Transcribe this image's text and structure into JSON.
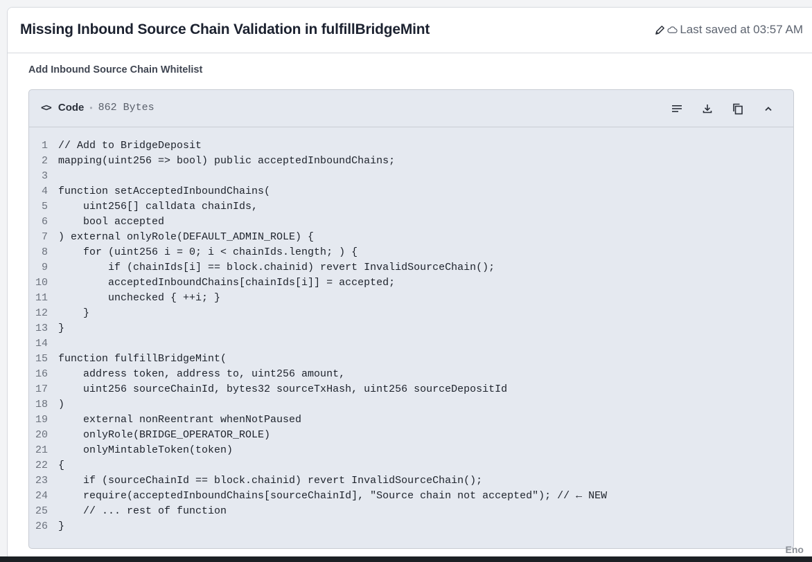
{
  "header": {
    "title": "Missing Inbound Source Chain Validation in fulfillBridgeMint",
    "saved_text": "Last saved at 03:57 AM"
  },
  "section": {
    "label": "Add Inbound Source Chain Whitelist"
  },
  "code_block": {
    "label": "Code",
    "size": "862 Bytes",
    "icon_label": "<>",
    "actions": [
      "wrap-lines",
      "download",
      "copy",
      "collapse"
    ],
    "lines": [
      {
        "n": "1",
        "text": "// Add to BridgeDeposit"
      },
      {
        "n": "2",
        "text": "mapping(uint256 => bool) public acceptedInboundChains;"
      },
      {
        "n": "3",
        "text": ""
      },
      {
        "n": "4",
        "text": "function setAcceptedInboundChains("
      },
      {
        "n": "5",
        "text": "    uint256[] calldata chainIds,"
      },
      {
        "n": "6",
        "text": "    bool accepted"
      },
      {
        "n": "7",
        "text": ") external onlyRole(DEFAULT_ADMIN_ROLE) {"
      },
      {
        "n": "8",
        "text": "    for (uint256 i = 0; i < chainIds.length; ) {"
      },
      {
        "n": "9",
        "text": "        if (chainIds[i] == block.chainid) revert InvalidSourceChain();"
      },
      {
        "n": "10",
        "text": "        acceptedInboundChains[chainIds[i]] = accepted;"
      },
      {
        "n": "11",
        "text": "        unchecked { ++i; }"
      },
      {
        "n": "12",
        "text": "    }"
      },
      {
        "n": "13",
        "text": "}"
      },
      {
        "n": "14",
        "text": ""
      },
      {
        "n": "15",
        "text": "function fulfillBridgeMint("
      },
      {
        "n": "16",
        "text": "    address token, address to, uint256 amount,"
      },
      {
        "n": "17",
        "text": "    uint256 sourceChainId, bytes32 sourceTxHash, uint256 sourceDepositId"
      },
      {
        "n": "18",
        "text": ")"
      },
      {
        "n": "19",
        "text": "    external nonReentrant whenNotPaused"
      },
      {
        "n": "20",
        "text": "    onlyRole(BRIDGE_OPERATOR_ROLE)"
      },
      {
        "n": "21",
        "text": "    onlyMintableToken(token)"
      },
      {
        "n": "22",
        "text": "{"
      },
      {
        "n": "23",
        "text": "    if (sourceChainId == block.chainid) revert InvalidSourceChain();"
      },
      {
        "n": "24",
        "text": "    require(acceptedInboundChains[sourceChainId], \"Source chain not accepted\"); // ← NEW"
      },
      {
        "n": "25",
        "text": "    // ... rest of function"
      },
      {
        "n": "26",
        "text": "}"
      }
    ]
  },
  "watermark": "Eno"
}
